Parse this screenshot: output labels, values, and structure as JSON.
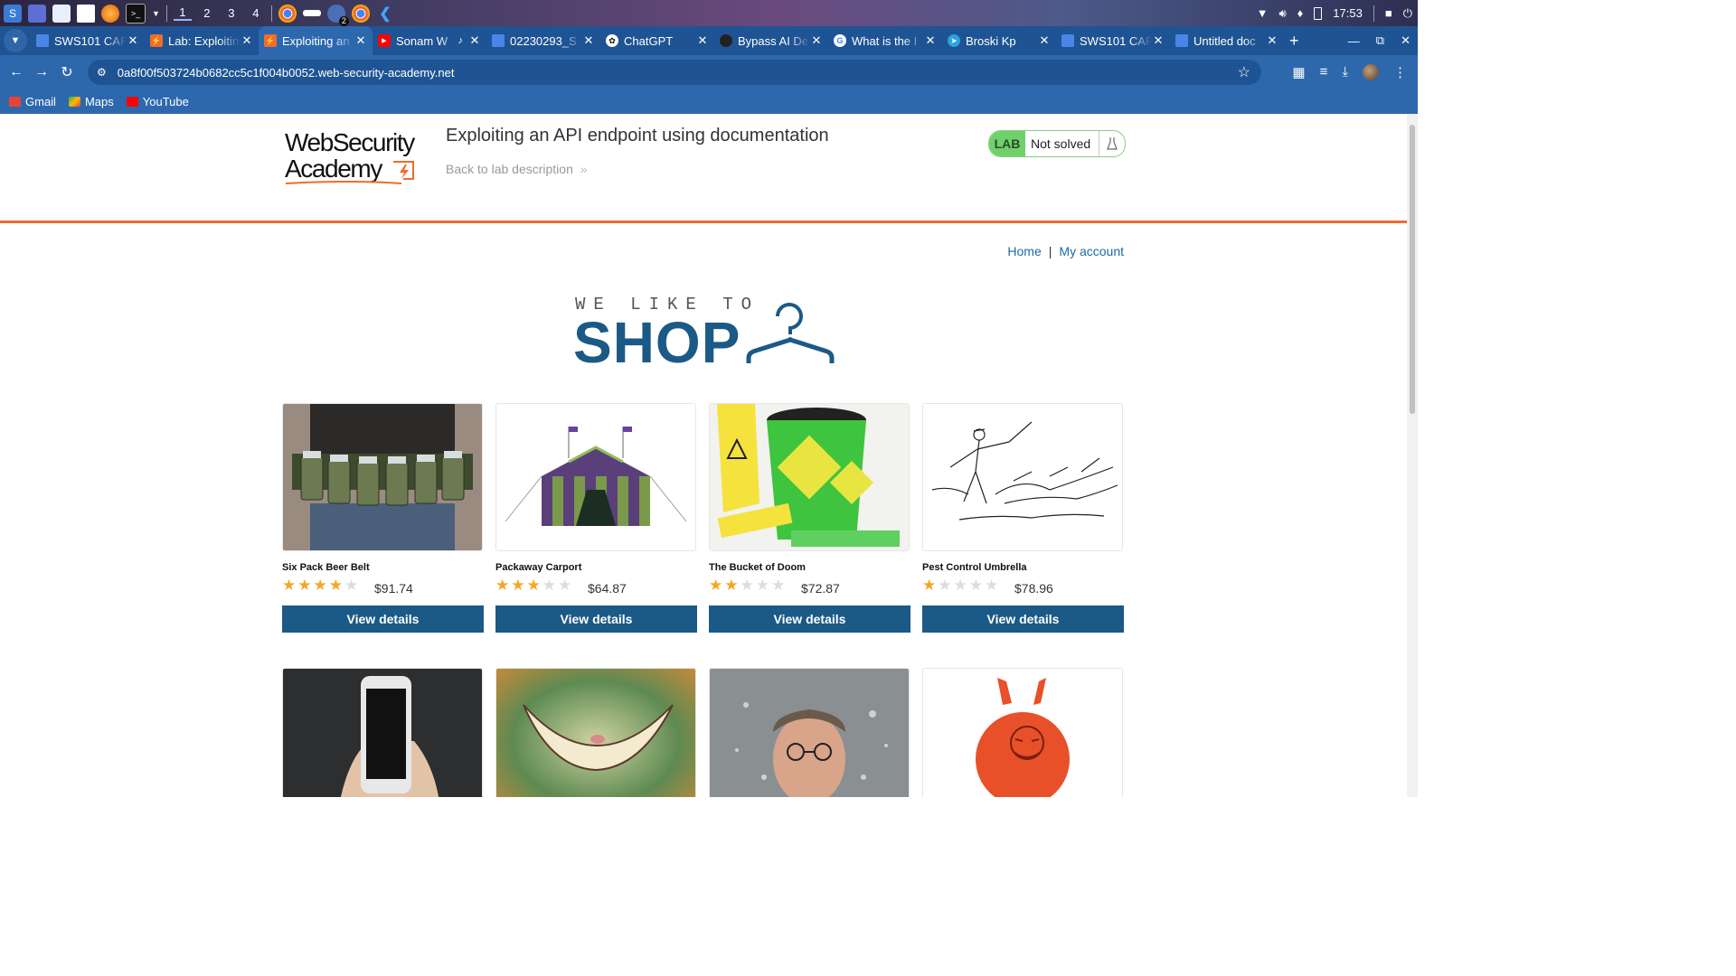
{
  "taskbar": {
    "workspaces": [
      "1",
      "2",
      "3",
      "4"
    ],
    "badge": "2",
    "clock": "17:53"
  },
  "tabs": [
    {
      "label": "SWS101 CAP",
      "icon": "docs-icon",
      "color": "#4a86e8"
    },
    {
      "label": "Lab: Exploiting",
      "icon": "portswigger-icon",
      "color": "#ee6c2d"
    },
    {
      "label": "Exploiting an",
      "icon": "portswigger-icon",
      "color": "#ee6c2d",
      "active": true
    },
    {
      "label": "Sonam W",
      "icon": "youtube-icon",
      "color": "#ff0000"
    },
    {
      "label": "02230293_S",
      "icon": "docs-icon",
      "color": "#4a86e8"
    },
    {
      "label": "ChatGPT",
      "icon": "chatgpt-icon",
      "color": "#444444"
    },
    {
      "label": "Bypass AI De",
      "icon": "globe-icon",
      "color": "#222222"
    },
    {
      "label": "What is the I",
      "icon": "google-icon",
      "color": "#ffffff"
    },
    {
      "label": "Broski Kp",
      "icon": "telegram-icon",
      "color": "#2aa3df"
    },
    {
      "label": "SWS101 CAP",
      "icon": "docs-icon",
      "color": "#4a86e8"
    },
    {
      "label": "Untitled doc",
      "icon": "docs-icon",
      "color": "#4a86e8"
    }
  ],
  "address_bar": {
    "url": "0a8f00f503724b0682cc5c1f004b0052.web-security-academy.net"
  },
  "bookmarks": [
    {
      "label": "Gmail",
      "color": "#ea4335"
    },
    {
      "label": "Maps",
      "color": "#34a853"
    },
    {
      "label": "YouTube",
      "color": "#ff0000"
    }
  ],
  "header": {
    "logo_line1": "WebSecurity",
    "logo_line2": "Academy",
    "lab_title": "Exploiting an API endpoint using documentation",
    "back_link": "Back to lab description",
    "lab_badge": "LAB",
    "lab_status": "Not solved"
  },
  "nav": {
    "home": "Home",
    "separator": "|",
    "my_account": "My account"
  },
  "banner": {
    "small": "WE LIKE TO",
    "big": "SHOP"
  },
  "products": [
    {
      "name": "Six Pack Beer Belt",
      "price": "$91.74",
      "rating": 4,
      "button": "View details"
    },
    {
      "name": "Packaway Carport",
      "price": "$64.87",
      "rating": 3,
      "button": "View details"
    },
    {
      "name": "The Bucket of Doom",
      "price": "$72.87",
      "rating": 2,
      "button": "View details"
    },
    {
      "name": "Pest Control Umbrella",
      "price": "$78.96",
      "rating": 1,
      "button": "View details"
    }
  ],
  "products_row2_images": [
    "phone-in-hand",
    "cheshire-grin",
    "water-splash-face",
    "orange-space-hopper"
  ],
  "colors": {
    "accent_orange": "#ee6c2d",
    "brand_blue": "#1b5a86",
    "lab_green": "#70d16b",
    "star": "#f5a623"
  }
}
